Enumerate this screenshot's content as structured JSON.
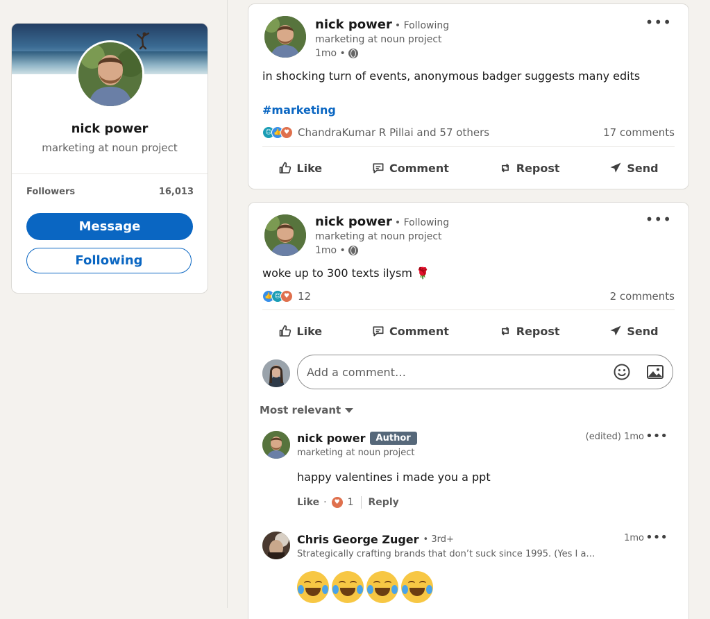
{
  "profile": {
    "name": "nick power",
    "title": "marketing at noun project",
    "followers_label": "Followers",
    "followers_count": "16,013",
    "message_label": "Message",
    "following_label": "Following"
  },
  "posts": [
    {
      "author": "nick power",
      "follow_status": "• Following",
      "subtitle": "marketing at noun project",
      "time": "1mo •",
      "text": "in shocking turn of events, anonymous badger suggests many edits",
      "hashtag": "#marketing",
      "reaction_text": "ChandraKumar R Pillai and 57 others",
      "comments": "17 comments"
    },
    {
      "author": "nick power",
      "follow_status": "• Following",
      "subtitle": "marketing at noun project",
      "time": "1mo •",
      "text": "woke up to 300 texts ilysm 🌹",
      "reaction_text": "12",
      "comments": "2 comments"
    }
  ],
  "actions": {
    "like": "Like",
    "comment": "Comment",
    "repost": "Repost",
    "send": "Send"
  },
  "comment_box": {
    "placeholder": "Add a comment…"
  },
  "sort_label": "Most relevant",
  "comments": [
    {
      "name": "nick power",
      "badge": "Author",
      "subtitle": "marketing at noun project",
      "meta": "(edited) 1mo",
      "text": "happy valentines i made you a ppt",
      "like_label": "Like",
      "dot": "·",
      "reaction_count": "1",
      "reply_label": "Reply"
    },
    {
      "name": "Chris George Zuger",
      "degree": "• 3rd+",
      "subtitle": "Strategically crafting brands that don’t suck since 1995. (Yes I a…",
      "meta": "1mo"
    }
  ],
  "icons": {
    "more": "more-dots-icon",
    "globe": "globe-icon",
    "like": "thumbs-up-icon",
    "comment": "speech-bubble-icon",
    "repost": "repost-arrows-icon",
    "send": "paper-plane-icon",
    "emoji": "smiley-icon",
    "photo": "image-icon"
  },
  "colors": {
    "brand": "#0a66c2",
    "page_bg": "#f4f2ee",
    "author_badge": "#56687a"
  }
}
